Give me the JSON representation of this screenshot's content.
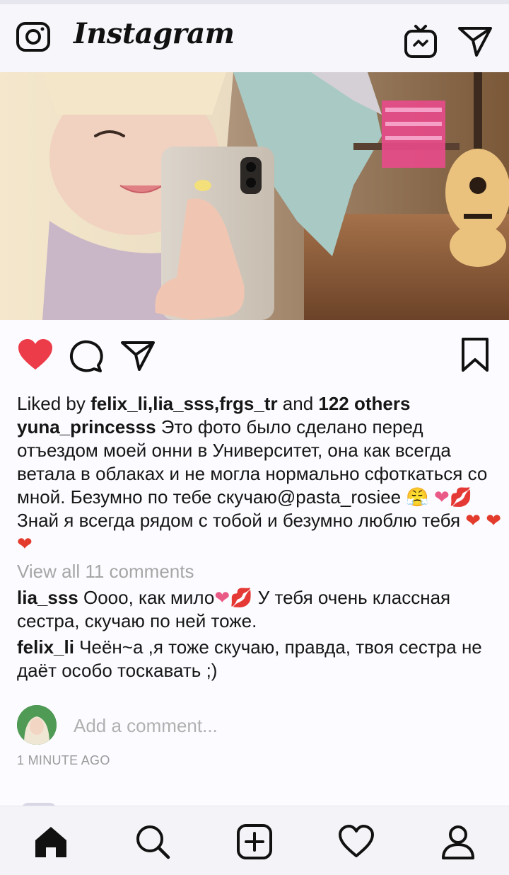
{
  "header": {
    "logo_text": "Instagram",
    "icons": [
      "camera-icon",
      "igtv-icon",
      "direct-message-icon"
    ]
  },
  "post": {
    "image_alt": "Girl taking a mirror selfie with phone",
    "liked_by_prefix": "Liked by ",
    "liked_by_users": "felix_li,lia_sss,frgs_tr",
    "liked_by_and": " and ",
    "liked_by_others": "122 others",
    "author": "yuna_princesss",
    "caption_part1": " Это фото было сделано перед отъездом моей онни в Университет, она как всегда ветала в облаках и не могла нормально сфоткаться со мной. Безумно по тебе скучаю@pasta_rosiee ",
    "caption_emoji1": "😤",
    "caption_emoji2": "❤",
    "caption_emoji3": "💋",
    "caption_part2": "Знай я всегда рядом с тобой и безумно люблю тебя ",
    "caption_hearts": "❤ ❤ ❤",
    "view_all": "View all 11 comments",
    "comments": [
      {
        "user": "lia_sss",
        "text_a": " Оооо, как мило",
        "emoji": "❤💋",
        "text_b": " У тебя очень классная сестра, скучаю по ней тоже."
      },
      {
        "user": "felix_li",
        "text": " Чеён~а ,я тоже скучаю, правда, твоя сестра не даёт особо тоскавать ;)"
      }
    ],
    "add_comment_placeholder": "Add a comment...",
    "time_ago": "1 MINUTE AGO"
  },
  "colors": {
    "like_red": "#ed3c49",
    "text": "#161616",
    "muted": "#a6a6a6"
  },
  "bottom_nav": [
    "home-icon",
    "search-icon",
    "new-post-icon",
    "activity-heart-icon",
    "profile-icon"
  ]
}
